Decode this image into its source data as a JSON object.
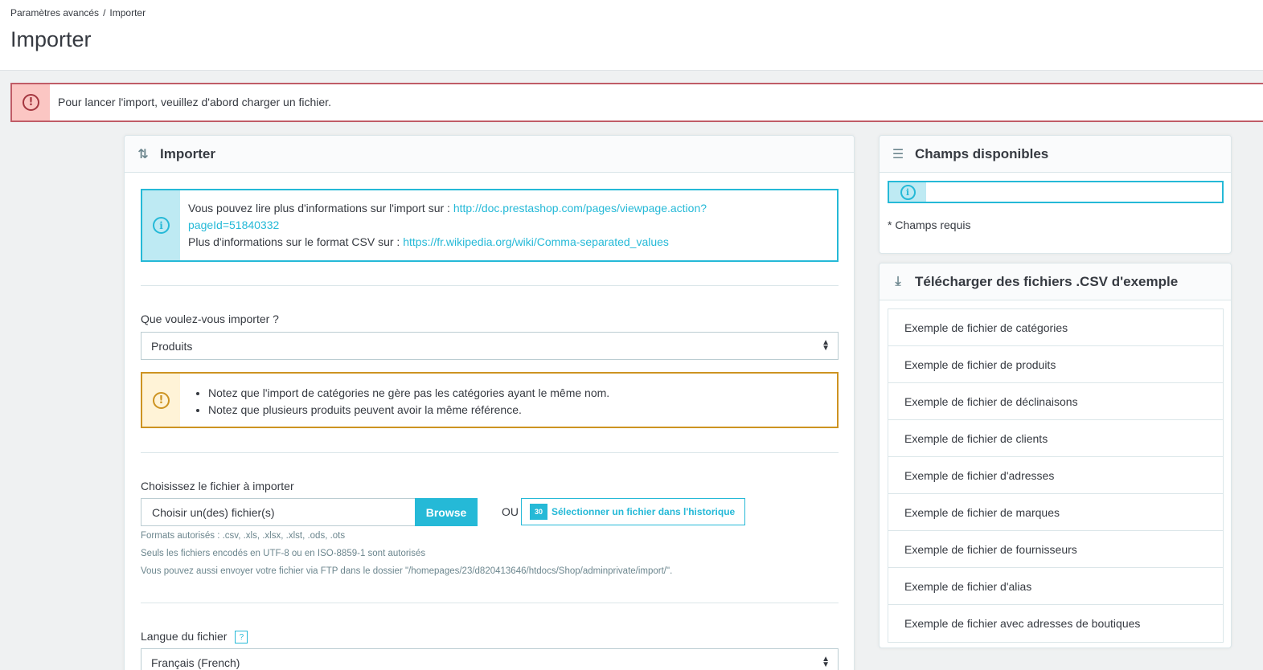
{
  "breadcrumb": {
    "parent": "Paramètres avancés",
    "separator": "/",
    "current": "Importer"
  },
  "page_title": "Importer",
  "alert": {
    "text": "Pour lancer l'import, veuillez d'abord charger un fichier.",
    "icon": "alert-circle-icon"
  },
  "import_card": {
    "title": "Importer",
    "info": {
      "line1_prefix": "Vous pouvez lire plus d'informations sur l'import sur :",
      "line1_link": "http://doc.prestashop.com/pages/viewpage.action?pageId=51840332",
      "line1_link_part1": "http://doc.prestashop.com/pages/viewpage.action?",
      "line1_link_part2": "pageId=51840332",
      "line2_prefix": "Plus d'informations sur le format CSV sur :",
      "line2_link": "https://fr.wikipedia.org/wiki/Comma-separated_values"
    },
    "entity_label": "Que voulez-vous importer ?",
    "entity_value": "Produits",
    "warnings": [
      "Notez que l'import de catégories ne gère pas les catégories ayant le même nom.",
      "Notez que plusieurs produits peuvent avoir la même référence."
    ],
    "file_label": "Choisissez le fichier à importer",
    "file_placeholder": "Choisir un(des) fichier(s)",
    "browse_label": "Browse",
    "or_label": "OU",
    "history_day": "30",
    "history_label": "Sélectionner un fichier dans l'historique",
    "help": [
      "Formats autorisés : .csv, .xls, .xlsx, .xlst, .ods, .ots",
      "Seuls les fichiers encodés en UTF-8 ou en ISO-8859-1 sont autorisés",
      "Vous pouvez aussi envoyer votre fichier via FTP dans le dossier \"/homepages/23/d820413646/htdocs/Shop/adminprivate/import/\"."
    ],
    "lang_label": "Langue du fichier",
    "lang_help": "?",
    "lang_value": "Français (French)"
  },
  "fields_card": {
    "title": "Champs disponibles",
    "required_note": "* Champs requis"
  },
  "csv_card": {
    "title": "Télécharger des fichiers .CSV d'exemple",
    "items": [
      "Exemple de fichier de catégories",
      "Exemple de fichier de produits",
      "Exemple de fichier de déclinaisons",
      "Exemple de fichier de clients",
      "Exemple de fichier d'adresses",
      "Exemple de fichier de marques",
      "Exemple de fichier de fournisseurs",
      "Exemple de fichier d'alias",
      "Exemple de fichier avec adresses de boutiques"
    ]
  },
  "colors": {
    "accent": "#25b9d7",
    "danger": "#c05c67",
    "warning": "#cd9321",
    "text": "#363a41"
  }
}
